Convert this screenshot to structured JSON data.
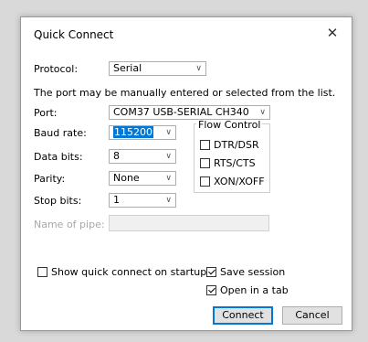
{
  "dialog": {
    "title": "Quick Connect",
    "close_glyph": "✕"
  },
  "protocol": {
    "label": "Protocol:",
    "value": "Serial"
  },
  "hint": "The port may be manually entered or selected from the list.",
  "port": {
    "label": "Port:",
    "value": "COM37 USB-SERIAL CH340"
  },
  "baud": {
    "label": "Baud rate:",
    "value": "115200"
  },
  "data_bits": {
    "label": "Data bits:",
    "value": "8"
  },
  "parity": {
    "label": "Parity:",
    "value": "None"
  },
  "stop_bits": {
    "label": "Stop bits:",
    "value": "1"
  },
  "pipe": {
    "label": "Name of pipe:",
    "value": ""
  },
  "flow_control": {
    "title": "Flow Control",
    "options": [
      {
        "label": "DTR/DSR",
        "checked": false
      },
      {
        "label": "RTS/CTS",
        "checked": false
      },
      {
        "label": "XON/XOFF",
        "checked": false
      }
    ]
  },
  "show_quick_connect": {
    "label": "Show quick connect on startup",
    "checked": false
  },
  "save_session": {
    "label": "Save session",
    "checked": true
  },
  "open_in_tab": {
    "label": "Open in a tab",
    "checked": true
  },
  "buttons": {
    "connect": "Connect",
    "cancel": "Cancel"
  },
  "icons": {
    "dropdown": "chevron-down-icon",
    "close": "close-icon",
    "check": "checkmark-icon"
  }
}
